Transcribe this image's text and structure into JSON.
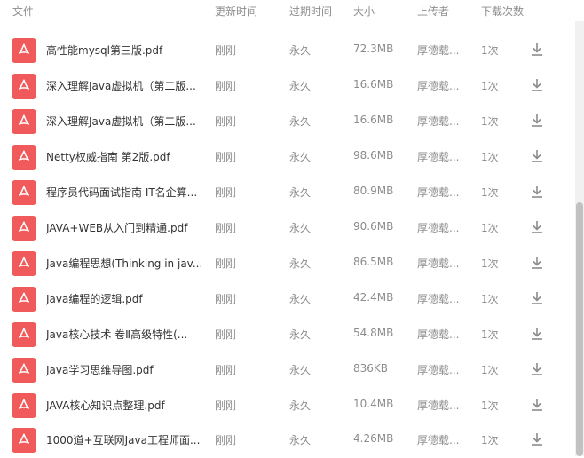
{
  "columns": {
    "file": "文件",
    "updated": "更新时间",
    "expiry": "过期时间",
    "size": "大小",
    "uploader": "上传者",
    "downloads": "下载次数"
  },
  "colors": {
    "pdf_icon": "#f05a5a",
    "text": "#333333",
    "muted": "#8c8c8c"
  },
  "files": [
    {
      "name": "",
      "updated": "",
      "expiry": "",
      "size": "",
      "uploader": "",
      "downloads": ""
    },
    {
      "name": "高性能mysql第三版.pdf",
      "updated": "刚刚",
      "expiry": "永久",
      "size": "72.3MB",
      "uploader": "厚德载...",
      "downloads": "1次"
    },
    {
      "name": "深入理解Java虚拟机（第二版...",
      "updated": "刚刚",
      "expiry": "永久",
      "size": "16.6MB",
      "uploader": "厚德载...",
      "downloads": "1次"
    },
    {
      "name": "深入理解Java虚拟机（第二版...",
      "updated": "刚刚",
      "expiry": "永久",
      "size": "16.6MB",
      "uploader": "厚德载...",
      "downloads": "1次"
    },
    {
      "name": "Netty权威指南 第2版.pdf",
      "updated": "刚刚",
      "expiry": "永久",
      "size": "98.6MB",
      "uploader": "厚德载...",
      "downloads": "1次"
    },
    {
      "name": "程序员代码面试指南 IT名企算...",
      "updated": "刚刚",
      "expiry": "永久",
      "size": "80.9MB",
      "uploader": "厚德载...",
      "downloads": "1次"
    },
    {
      "name": "JAVA+WEB从入门到精通.pdf",
      "updated": "刚刚",
      "expiry": "永久",
      "size": "90.6MB",
      "uploader": "厚德载...",
      "downloads": "1次"
    },
    {
      "name": "Java编程思想(Thinking in jav...",
      "updated": "刚刚",
      "expiry": "永久",
      "size": "86.5MB",
      "uploader": "厚德载...",
      "downloads": "1次"
    },
    {
      "name": "Java编程的逻辑.pdf",
      "updated": "刚刚",
      "expiry": "永久",
      "size": "42.4MB",
      "uploader": "厚德载...",
      "downloads": "1次"
    },
    {
      "name": "Java核心技术 卷Ⅱ高级特性(...",
      "updated": "刚刚",
      "expiry": "永久",
      "size": "54.8MB",
      "uploader": "厚德载...",
      "downloads": "1次"
    },
    {
      "name": "Java学习思维导图.pdf",
      "updated": "刚刚",
      "expiry": "永久",
      "size": "836KB",
      "uploader": "厚德载...",
      "downloads": "1次"
    },
    {
      "name": "JAVA核心知识点整理.pdf",
      "updated": "刚刚",
      "expiry": "永久",
      "size": "10.4MB",
      "uploader": "厚德载...",
      "downloads": "1次"
    },
    {
      "name": "1000道+互联网Java工程师面...",
      "updated": "刚刚",
      "expiry": "永久",
      "size": "4.26MB",
      "uploader": "厚德载...",
      "downloads": "1次"
    }
  ]
}
